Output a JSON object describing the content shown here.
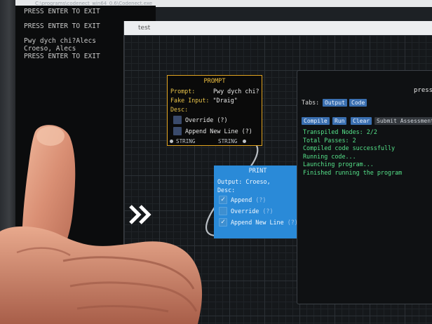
{
  "console": {
    "title": "C:\\programs\\codenect_win64_0.6\\Codenect.exe",
    "lines": [
      "PRESS ENTER TO EXIT",
      "",
      "PRESS ENTER TO EXIT",
      "",
      "Pwy dych chi?Alecs",
      "Croeso, Alecs",
      "PRESS ENTER TO EXIT"
    ]
  },
  "window": {
    "title": "test"
  },
  "prompt_node": {
    "title": "PROMPT",
    "prompt_label": "Prompt:",
    "prompt_value": "Pwy dych chi?",
    "fake_input_label": "Fake Input:",
    "fake_input_value": "\"Draig\"",
    "desc_label": "Desc:",
    "override_label": "Override (?)",
    "append_new_line_label": "Append New Line (?)",
    "in_pin_label": "STRING",
    "out_pin_label": "STRING"
  },
  "print_node": {
    "title": "PRINT",
    "output_label": "Output:",
    "output_value": "Croeso,",
    "desc_label": "Desc:",
    "options": [
      {
        "label": "Append",
        "help": "(?)",
        "checked": true
      },
      {
        "label": "Override",
        "help": "(?)",
        "checked": false
      },
      {
        "label": "Append New Line",
        "help": "(?)",
        "checked": true
      }
    ]
  },
  "panel": {
    "header": "press",
    "tabs_label": "Tabs:",
    "tabs": [
      "Output",
      "Code"
    ],
    "buttons": [
      "Compile",
      "Run",
      "Clear",
      "Submit Assessment"
    ],
    "output_lines": [
      "Transpiled Nodes: 2/2",
      "Total Passes: 2",
      "Compiled code successfully",
      "Running code...",
      "Launching program...",
      "Finished running the program"
    ]
  },
  "colors": {
    "prompt_border": "#e0a21e",
    "print_bg": "#2a8ad8",
    "output_text": "#56e38a",
    "button": "#3a6fb0"
  },
  "icons": [
    "chevron-right-icon",
    "check-icon",
    "thumbs-up-hand"
  ]
}
